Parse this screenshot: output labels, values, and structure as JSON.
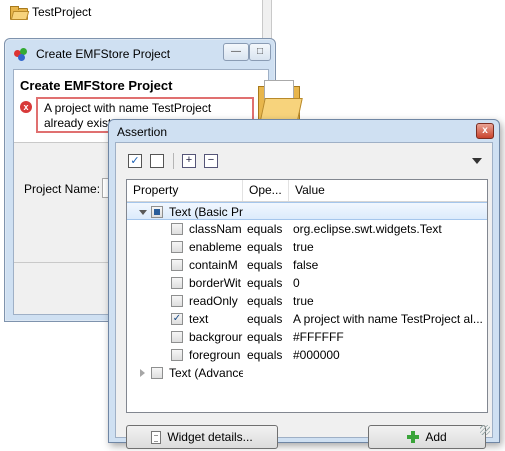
{
  "explorer": {
    "project_name": "TestProject"
  },
  "emf_dialog": {
    "title": "Create EMFStore Project",
    "heading": "Create EMFStore Project",
    "error_message": "A project with name TestProject already exists",
    "project_name_label": "Project Name:"
  },
  "assertion_dialog": {
    "title": "Assertion",
    "close_label": "x",
    "columns": {
      "property": "Property",
      "operator": "Ope...",
      "value": "Value"
    },
    "groups": [
      {
        "label": "Text (Basic Pr",
        "expanded": true,
        "checked": "partial"
      },
      {
        "label": "Text (Advance",
        "expanded": false,
        "checked": false
      }
    ],
    "rows": [
      {
        "property": "classNam",
        "op": "equals",
        "value": "org.eclipse.swt.widgets.Text",
        "checked": false
      },
      {
        "property": "enableme",
        "op": "equals",
        "value": "true",
        "checked": false
      },
      {
        "property": "containM",
        "op": "equals",
        "value": "false",
        "checked": false
      },
      {
        "property": "borderWit",
        "op": "equals",
        "value": "0",
        "checked": false
      },
      {
        "property": "readOnly",
        "op": "equals",
        "value": "true",
        "checked": false
      },
      {
        "property": "text",
        "op": "equals",
        "value": "A project with name TestProject al...",
        "checked": true
      },
      {
        "property": "backgrour",
        "op": "equals",
        "value": "#FFFFFF",
        "checked": false
      },
      {
        "property": "foregroun",
        "op": "equals",
        "value": "#000000",
        "checked": false
      }
    ],
    "buttons": {
      "details": "Widget details...",
      "add": "Add"
    }
  }
}
